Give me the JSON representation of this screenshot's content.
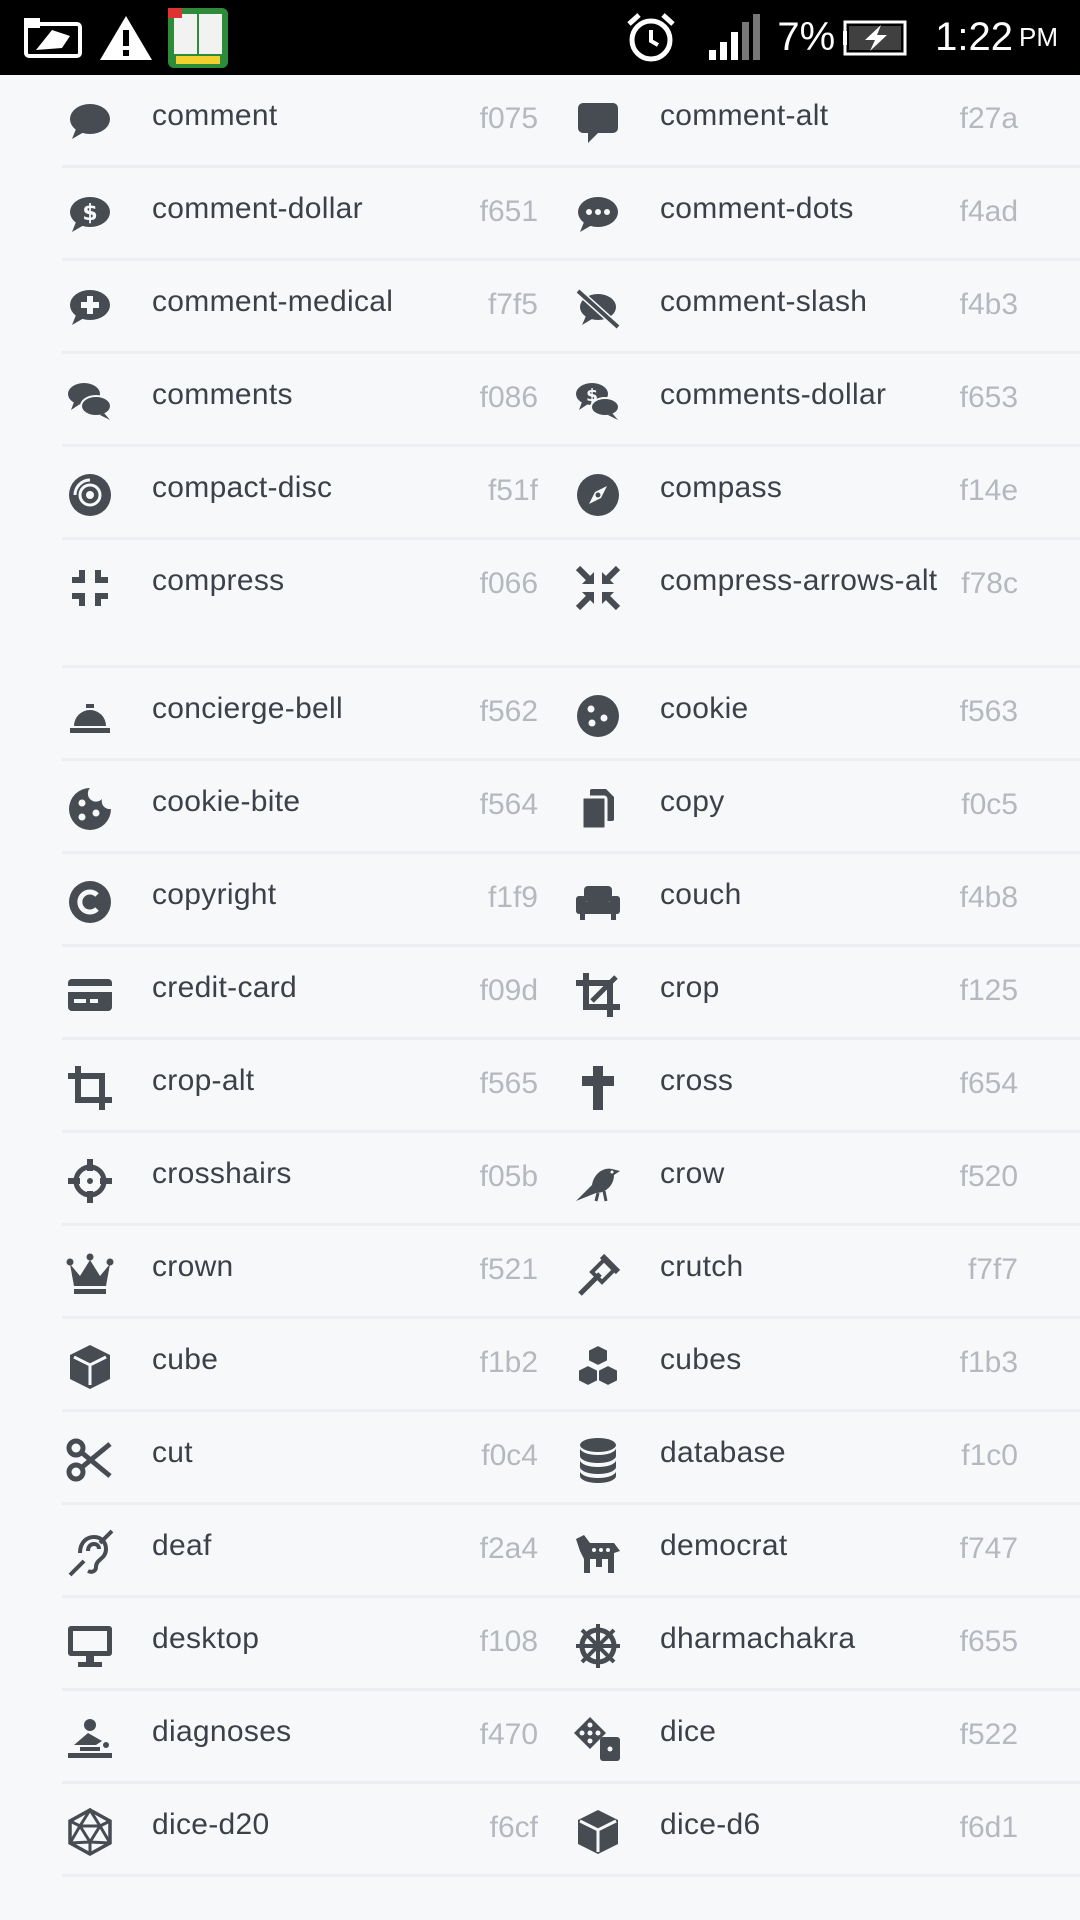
{
  "status_bar": {
    "battery_percent": "7%",
    "time": "1:22",
    "ampm": "PM",
    "icons": [
      "screenshot-icon",
      "warning-icon",
      "dictionary-app-icon",
      "alarm-icon",
      "signal-icon",
      "battery-charging-icon"
    ]
  },
  "colors": {
    "icon": "#474b52",
    "name": "#3c4048",
    "code": "#b5b9bf",
    "background": "#f7f8fa"
  },
  "icons": [
    {
      "name": "comment",
      "code": "f075",
      "icon": "comment-icon"
    },
    {
      "name": "comment-alt",
      "code": "f27a",
      "icon": "comment-alt-icon"
    },
    {
      "name": "comment-dollar",
      "code": "f651",
      "icon": "comment-dollar-icon"
    },
    {
      "name": "comment-dots",
      "code": "f4ad",
      "icon": "comment-dots-icon"
    },
    {
      "name": "comment-medical",
      "code": "f7f5",
      "icon": "comment-medical-icon"
    },
    {
      "name": "comment-slash",
      "code": "f4b3",
      "icon": "comment-slash-icon"
    },
    {
      "name": "comments",
      "code": "f086",
      "icon": "comments-icon"
    },
    {
      "name": "comments-dollar",
      "code": "f653",
      "icon": "comments-dollar-icon"
    },
    {
      "name": "compact-disc",
      "code": "f51f",
      "icon": "compact-disc-icon"
    },
    {
      "name": "compass",
      "code": "f14e",
      "icon": "compass-icon"
    },
    {
      "name": "compress",
      "code": "f066",
      "icon": "compress-icon"
    },
    {
      "name": "compress-arrows-alt",
      "code": "f78c",
      "icon": "compress-arrows-alt-icon"
    },
    {
      "name": "concierge-bell",
      "code": "f562",
      "icon": "concierge-bell-icon"
    },
    {
      "name": "cookie",
      "code": "f563",
      "icon": "cookie-icon"
    },
    {
      "name": "cookie-bite",
      "code": "f564",
      "icon": "cookie-bite-icon"
    },
    {
      "name": "copy",
      "code": "f0c5",
      "icon": "copy-icon"
    },
    {
      "name": "copyright",
      "code": "f1f9",
      "icon": "copyright-icon"
    },
    {
      "name": "couch",
      "code": "f4b8",
      "icon": "couch-icon"
    },
    {
      "name": "credit-card",
      "code": "f09d",
      "icon": "credit-card-icon"
    },
    {
      "name": "crop",
      "code": "f125",
      "icon": "crop-icon"
    },
    {
      "name": "crop-alt",
      "code": "f565",
      "icon": "crop-alt-icon"
    },
    {
      "name": "cross",
      "code": "f654",
      "icon": "cross-icon"
    },
    {
      "name": "crosshairs",
      "code": "f05b",
      "icon": "crosshairs-icon"
    },
    {
      "name": "crow",
      "code": "f520",
      "icon": "crow-icon"
    },
    {
      "name": "crown",
      "code": "f521",
      "icon": "crown-icon"
    },
    {
      "name": "crutch",
      "code": "f7f7",
      "icon": "crutch-icon"
    },
    {
      "name": "cube",
      "code": "f1b2",
      "icon": "cube-icon"
    },
    {
      "name": "cubes",
      "code": "f1b3",
      "icon": "cubes-icon"
    },
    {
      "name": "cut",
      "code": "f0c4",
      "icon": "cut-icon"
    },
    {
      "name": "database",
      "code": "f1c0",
      "icon": "database-icon"
    },
    {
      "name": "deaf",
      "code": "f2a4",
      "icon": "deaf-icon"
    },
    {
      "name": "democrat",
      "code": "f747",
      "icon": "democrat-icon"
    },
    {
      "name": "desktop",
      "code": "f108",
      "icon": "desktop-icon"
    },
    {
      "name": "dharmachakra",
      "code": "f655",
      "icon": "dharmachakra-icon"
    },
    {
      "name": "diagnoses",
      "code": "f470",
      "icon": "diagnoses-icon"
    },
    {
      "name": "dice",
      "code": "f522",
      "icon": "dice-icon"
    },
    {
      "name": "dice-d20",
      "code": "f6cf",
      "icon": "dice-d20-icon"
    },
    {
      "name": "dice-d6",
      "code": "f6d1",
      "icon": "dice-d6-icon"
    }
  ]
}
